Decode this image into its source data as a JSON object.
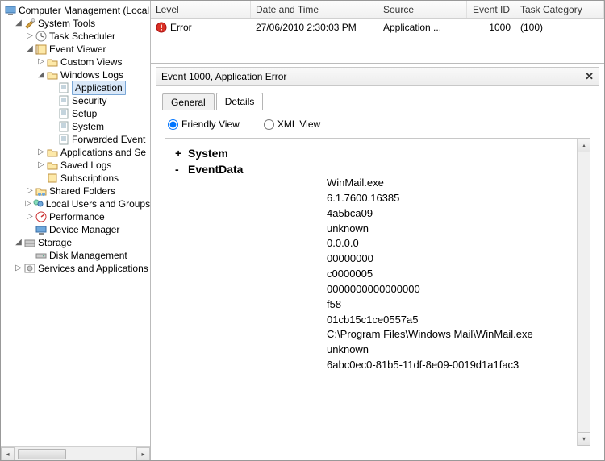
{
  "tree": {
    "root": "Computer Management (Local",
    "system_tools": "System Tools",
    "task_scheduler": "Task Scheduler",
    "event_viewer": "Event Viewer",
    "custom_views": "Custom Views",
    "windows_logs": "Windows Logs",
    "application": "Application",
    "security": "Security",
    "setup": "Setup",
    "system": "System",
    "forwarded": "Forwarded Event",
    "apps_services": "Applications and Se",
    "saved_logs": "Saved Logs",
    "subscriptions": "Subscriptions",
    "shared_folders": "Shared Folders",
    "local_users": "Local Users and Groups",
    "performance": "Performance",
    "device_manager": "Device Manager",
    "storage": "Storage",
    "disk_management": "Disk Management",
    "services_apps": "Services and Applications"
  },
  "list": {
    "headers": {
      "level": "Level",
      "date": "Date and Time",
      "source": "Source",
      "eventid": "Event ID",
      "task": "Task Category"
    },
    "row": {
      "level": "Error",
      "date": "27/06/2010 2:30:03 PM",
      "source": "Application ...",
      "eventid": "1000",
      "task": "(100)"
    }
  },
  "detail": {
    "title": "Event 1000, Application Error",
    "tabs": {
      "general": "General",
      "details": "Details"
    },
    "radios": {
      "friendly": "Friendly View",
      "xml": "XML View"
    },
    "sections": {
      "system": "System",
      "eventdata": "EventData"
    },
    "values": [
      "WinMail.exe",
      "6.1.7600.16385",
      "4a5bca09",
      "unknown",
      "0.0.0.0",
      "00000000",
      "c0000005",
      "0000000000000000",
      "f58",
      "01cb15c1ce0557a5",
      "C:\\Program Files\\Windows Mail\\WinMail.exe",
      "unknown",
      "6abc0ec0-81b5-11df-8e09-0019d1a1fac3"
    ]
  }
}
